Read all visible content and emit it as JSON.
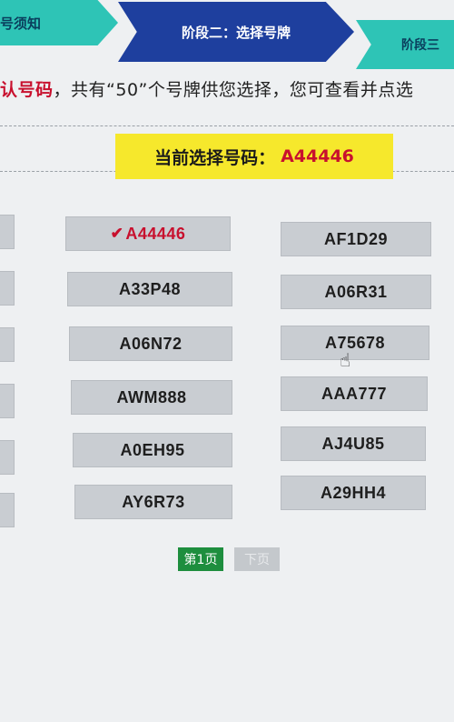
{
  "stages": [
    {
      "label": "号须知"
    },
    {
      "label": "阶段二：选择号牌"
    },
    {
      "label": "阶段三"
    }
  ],
  "notice": {
    "highlight": "认号码",
    "text": "，共有“50”个号牌供您选择，您可查看并点选"
  },
  "current": {
    "label": "当前选择号码：",
    "value": "A44446"
  },
  "plates": {
    "left": [
      "A44446",
      "A33P48",
      "A06N72",
      "AWM888",
      "A0EH95",
      "AY6R73"
    ],
    "right": [
      "AF1D29",
      "A06R31",
      "A75678",
      "AAA777",
      "AJ4U85",
      "A29HH4"
    ]
  },
  "pager": {
    "current": "第1页",
    "next": "下页"
  },
  "colors": {
    "stage_active": "#1e3f9e",
    "stage_inactive": "#2ec4b6",
    "highlight_red": "#c8102e",
    "current_bg": "#f6e82c",
    "pager_active": "#1e8e3e"
  },
  "icons": {
    "check": "check-icon",
    "cursor": "hand-pointer-icon"
  }
}
